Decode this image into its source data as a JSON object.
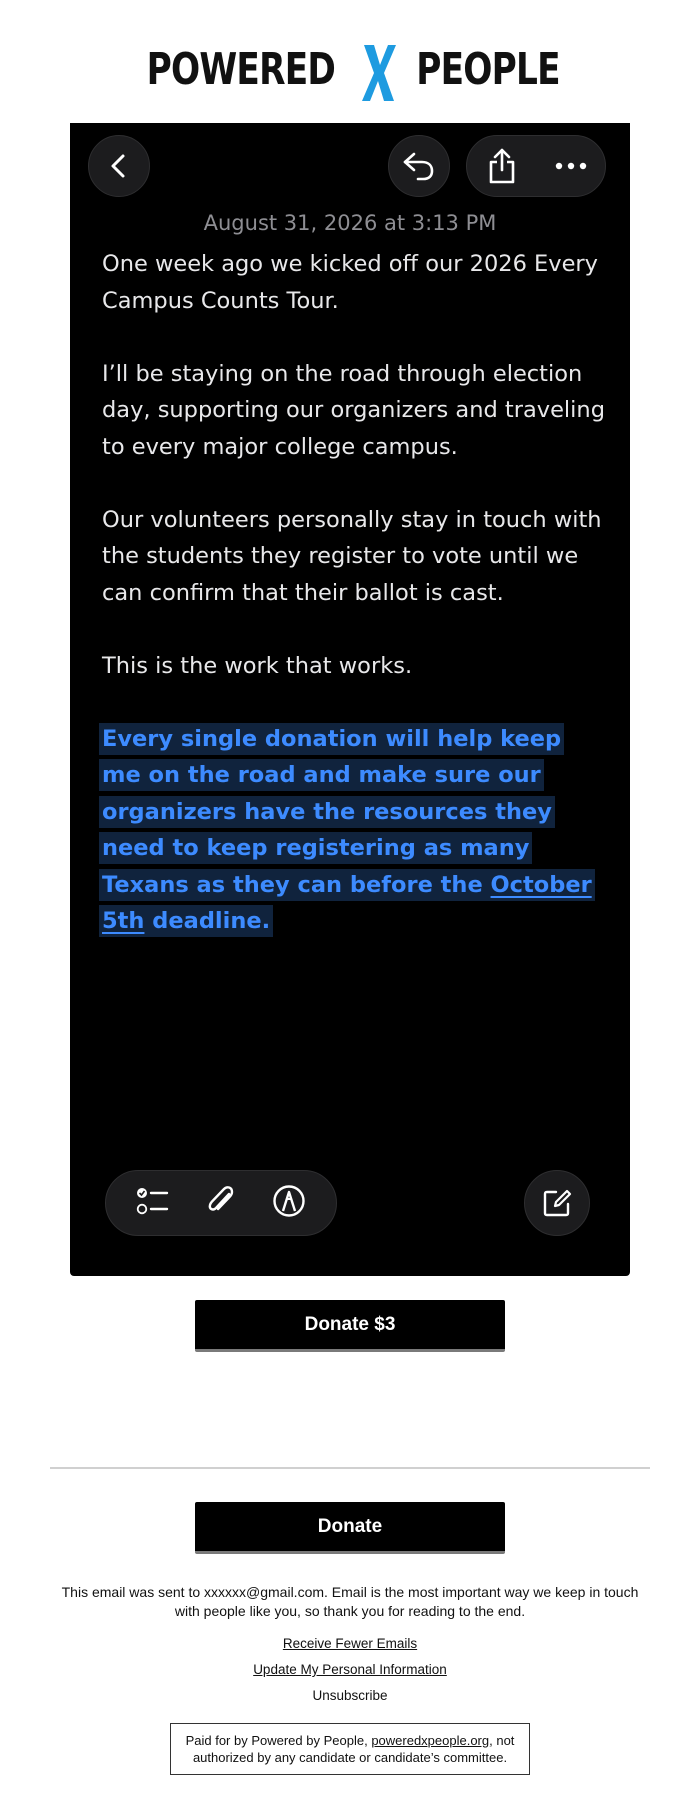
{
  "logo": {
    "left": "POWERED",
    "right": "PEOPLE",
    "x_color": "#1e9be0"
  },
  "note": {
    "date": "August 31, 2026 at 3:13 PM",
    "paragraphs": [
      "One week ago we kicked off our 2026 Every Campus Counts Tour.",
      "I’ll be staying on the road through election day, supporting our organizers and traveling to every major college campus.",
      "Our volunteers personally stay in touch with the students they register to vote until we can confirm that their ballot is cast.",
      "This is the work that works."
    ],
    "highlight": {
      "before": "Every single donation will help keep me on the road and make sure our organizers have the resources they need to keep registering as many Texans as they can before the ",
      "link": "October 5th",
      "after": " deadline."
    },
    "icons": {
      "back": "chevron-left-icon",
      "reply": "reply-arrow-icon",
      "share": "share-icon",
      "more": "ellipsis-icon",
      "checklist": "checklist-icon",
      "attach": "paperclip-icon",
      "markup": "markup-pen-icon",
      "compose": "compose-icon"
    },
    "highlight_color": "#3d8bff"
  },
  "donate_small": {
    "label": "Donate $3"
  },
  "donate_main": {
    "label": "Donate"
  },
  "footer": {
    "note": "This email was sent to xxxxxx@gmail.com. Email is the most important way we keep in touch with people like you, so thank you for reading to the end.",
    "links": [
      "Receive Fewer Emails",
      "Update My Personal Information",
      "Unsubscribe"
    ],
    "paid_before": "Paid for by Powered by People, ",
    "paid_link": "poweredxpeople.org",
    "paid_after": ", not authorized by any candidate or candidate’s committee."
  }
}
